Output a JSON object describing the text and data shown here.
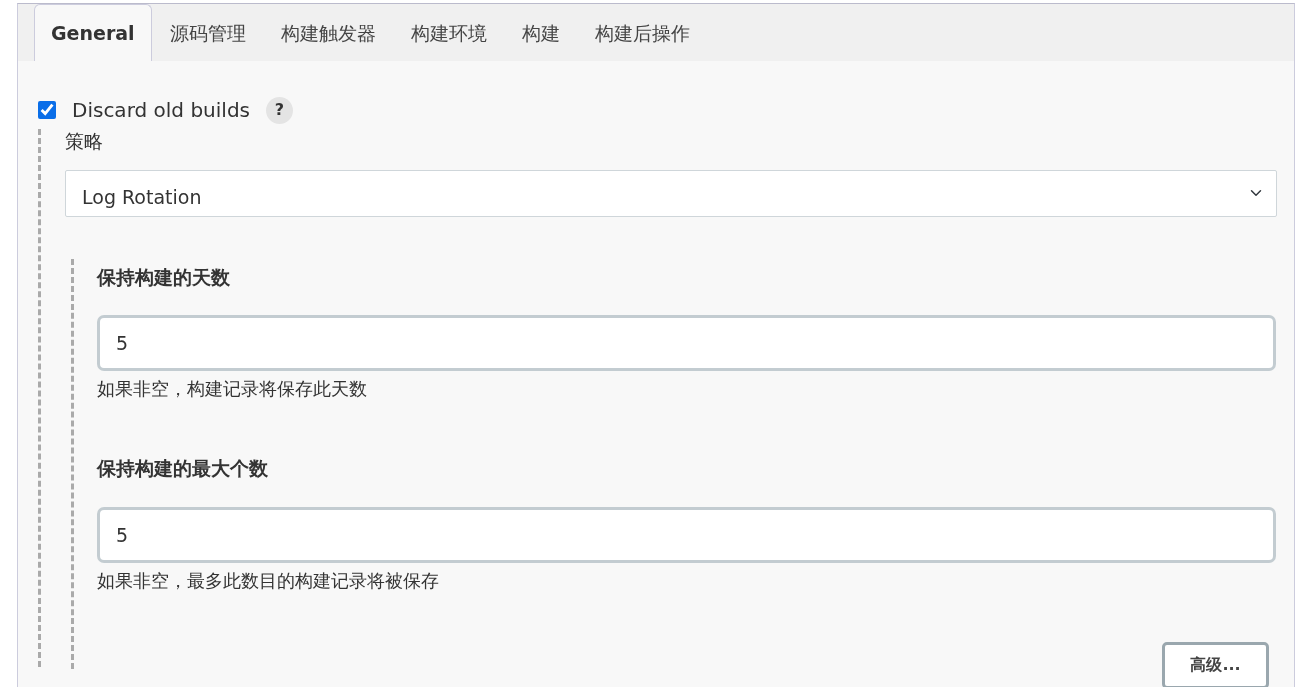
{
  "tabs": [
    {
      "label": "General",
      "selected": true
    },
    {
      "label": "源码管理",
      "selected": false
    },
    {
      "label": "构建触发器",
      "selected": false
    },
    {
      "label": "构建环境",
      "selected": false
    },
    {
      "label": "构建",
      "selected": false
    },
    {
      "label": "构建后操作",
      "selected": false
    }
  ],
  "discard_old_builds": {
    "label": "Discard old builds",
    "checked": true,
    "help": "?",
    "strategy": {
      "label": "策略",
      "value": "Log Rotation"
    },
    "fields": [
      {
        "label": "保持构建的天数",
        "value": "5",
        "hint": "如果非空，构建记录将保存此天数"
      },
      {
        "label": "保持构建的最大个数",
        "value": "5",
        "hint": "如果非空，最多此数目的构建记录将被保存"
      }
    ],
    "advanced_button": "高级..."
  }
}
